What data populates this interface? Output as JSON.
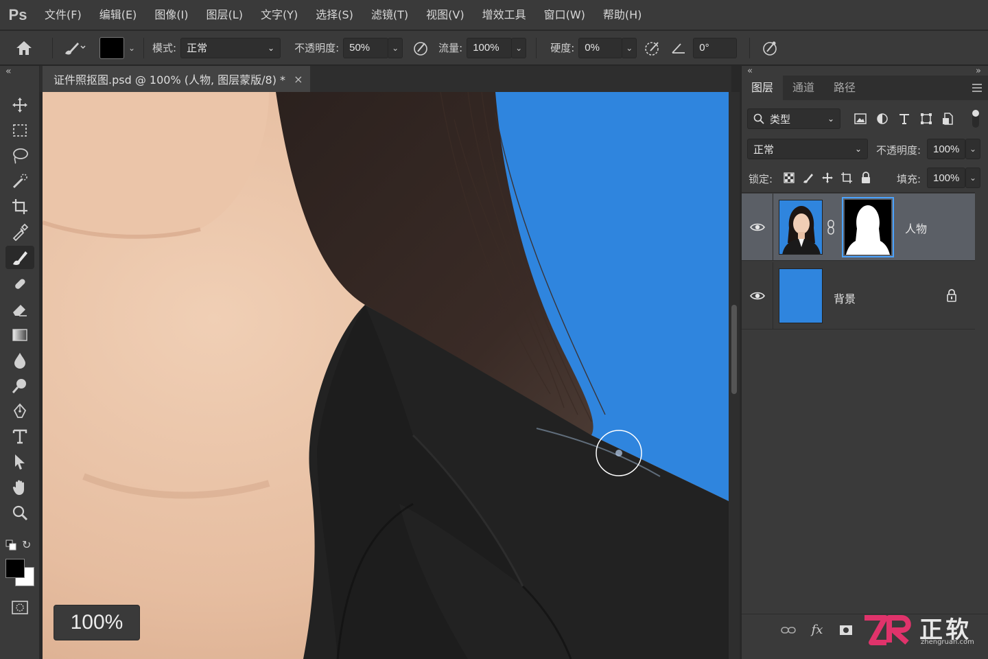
{
  "app": {
    "logo": "Ps"
  },
  "menu": [
    "文件(F)",
    "编辑(E)",
    "图像(I)",
    "图层(L)",
    "文字(Y)",
    "选择(S)",
    "滤镜(T)",
    "视图(V)",
    "增效工具",
    "窗口(W)",
    "帮助(H)"
  ],
  "options": {
    "mode_label": "模式:",
    "mode_value": "正常",
    "opacity_label": "不透明度:",
    "opacity_value": "50%",
    "flow_label": "流量:",
    "flow_value": "100%",
    "hardness_label": "硬度:",
    "hardness_value": "0%",
    "angle_value": "0°",
    "foreground_color": "#000000"
  },
  "document": {
    "tab_title": "证件照抠图.psd @ 100% (人物, 图层蒙版/8) *",
    "close_glyph": "×",
    "zoom": "100%",
    "background_color": "#2f85de"
  },
  "toolbar": {
    "active_tool": "brush",
    "foreground_color": "#000000",
    "background_color": "#ffffff",
    "tools": [
      "move-icon",
      "marquee-icon",
      "lasso-icon",
      "quick-selection-icon",
      "crop-icon",
      "eyedropper-icon",
      "brush-icon",
      "healing-icon",
      "eraser-icon",
      "gradient-icon",
      "blur-icon",
      "dodge-icon",
      "pen-icon",
      "type-icon",
      "path-selection-icon",
      "hand-icon",
      "zoom-icon"
    ]
  },
  "layers_panel": {
    "tabs": [
      "图层",
      "通道",
      "路径"
    ],
    "filter_label": "类型",
    "blend_mode": "正常",
    "opacity_label": "不透明度:",
    "opacity_value": "100%",
    "lock_label": "锁定:",
    "fill_label": "填充:",
    "fill_value": "100%",
    "layers": [
      {
        "name": "人物",
        "visible": true,
        "selected": true,
        "has_mask": true,
        "locked": false
      },
      {
        "name": "背景",
        "visible": true,
        "selected": false,
        "has_mask": false,
        "locked": true,
        "thumb_color": "#2f85de"
      }
    ],
    "footer_icons": [
      "link-icon",
      "fx-icon",
      "add-mask-icon"
    ]
  },
  "watermark": {
    "brand": "正软",
    "site": "zhengruan.com"
  }
}
